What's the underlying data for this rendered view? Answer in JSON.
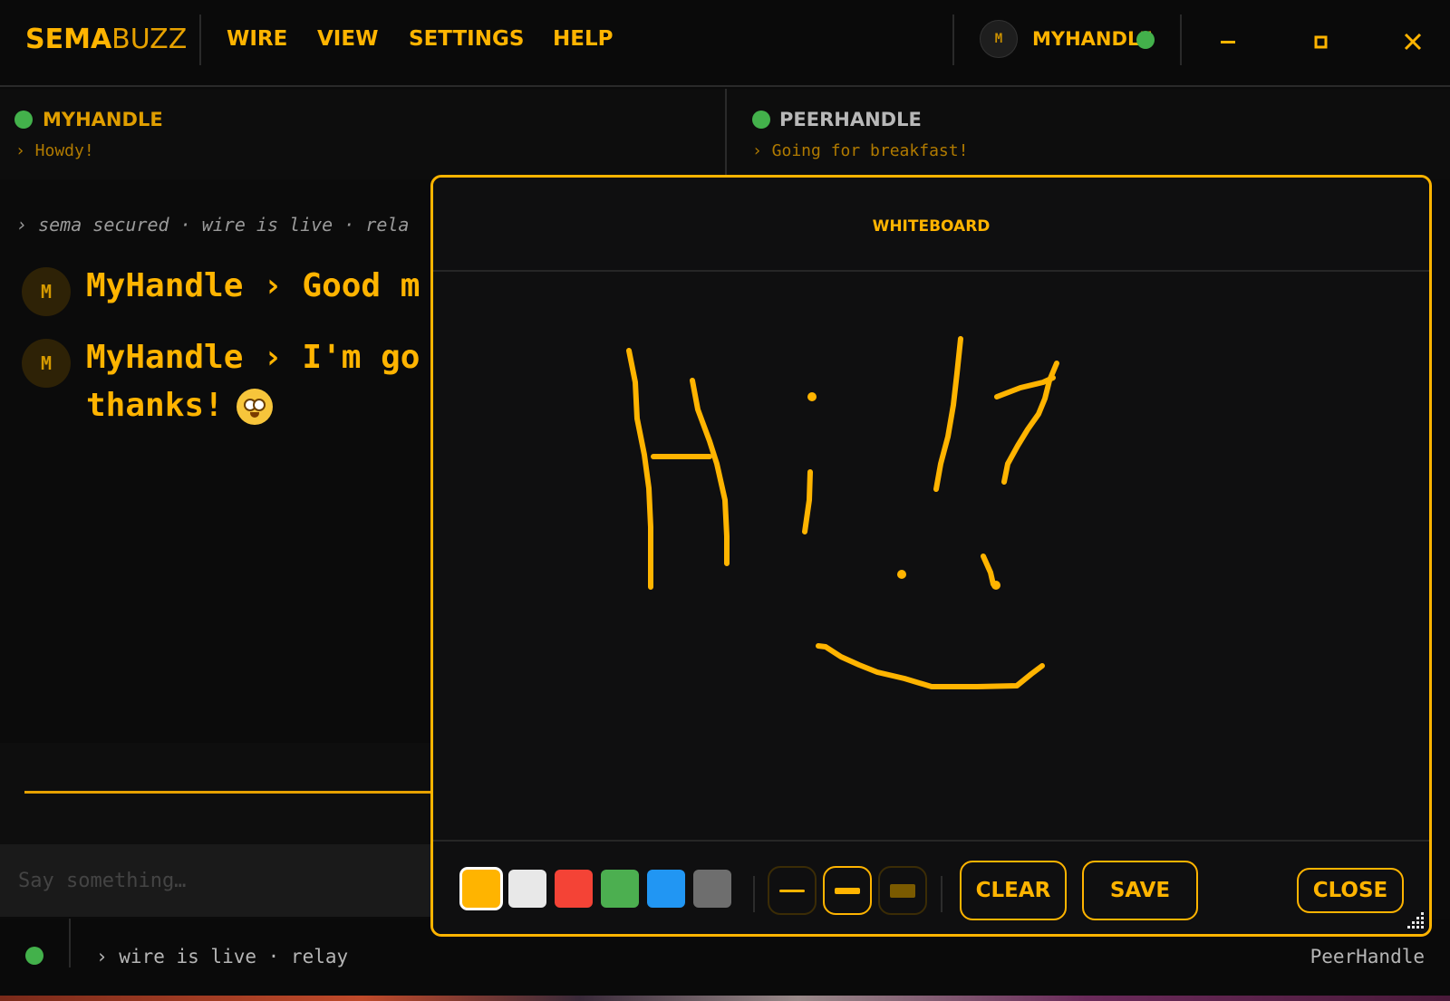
{
  "app": {
    "logo_part1": "SEMA",
    "logo_part2": "BUZZ",
    "menu": [
      "WIRE",
      "VIEW",
      "SETTINGS",
      "HELP"
    ],
    "user_initial": "M",
    "user_handle": "MYHANDLE",
    "window_controls": [
      "minimize-icon",
      "maximize-icon",
      "close-icon"
    ]
  },
  "status": {
    "self": {
      "name": "MYHANDLE",
      "message": "› Howdy!"
    },
    "peer": {
      "name": "PEERHANDLE",
      "message": "› Going for breakfast!"
    }
  },
  "chat": {
    "system_line": "› sema secured · wire is live · rela",
    "messages": [
      {
        "initial": "M",
        "text": "MyHandle › Good m"
      },
      {
        "initial": "M",
        "text": "MyHandle › I'm go",
        "text2": "thanks!",
        "emoji": "smiling-face-icon"
      }
    ],
    "composer_placeholder": "Say something…"
  },
  "footer": {
    "status_text": "› wire is live · relay",
    "peer_name": "PeerHandle"
  },
  "whiteboard": {
    "title": "WHITEBOARD",
    "colors": [
      "#ffb400",
      "#e8e8e8",
      "#f44336",
      "#4caf50",
      "#2196f3",
      "#6e6e6e"
    ],
    "selected_color": "#ffb400",
    "stroke_widths": [
      "thin",
      "medium",
      "thick"
    ],
    "selected_width": "medium",
    "buttons": {
      "clear": "CLEAR",
      "save": "SAVE",
      "close": "CLOSE"
    }
  },
  "colors": {
    "accent": "#ffb400",
    "online": "#43b14b",
    "background": "#0b0b0b"
  }
}
